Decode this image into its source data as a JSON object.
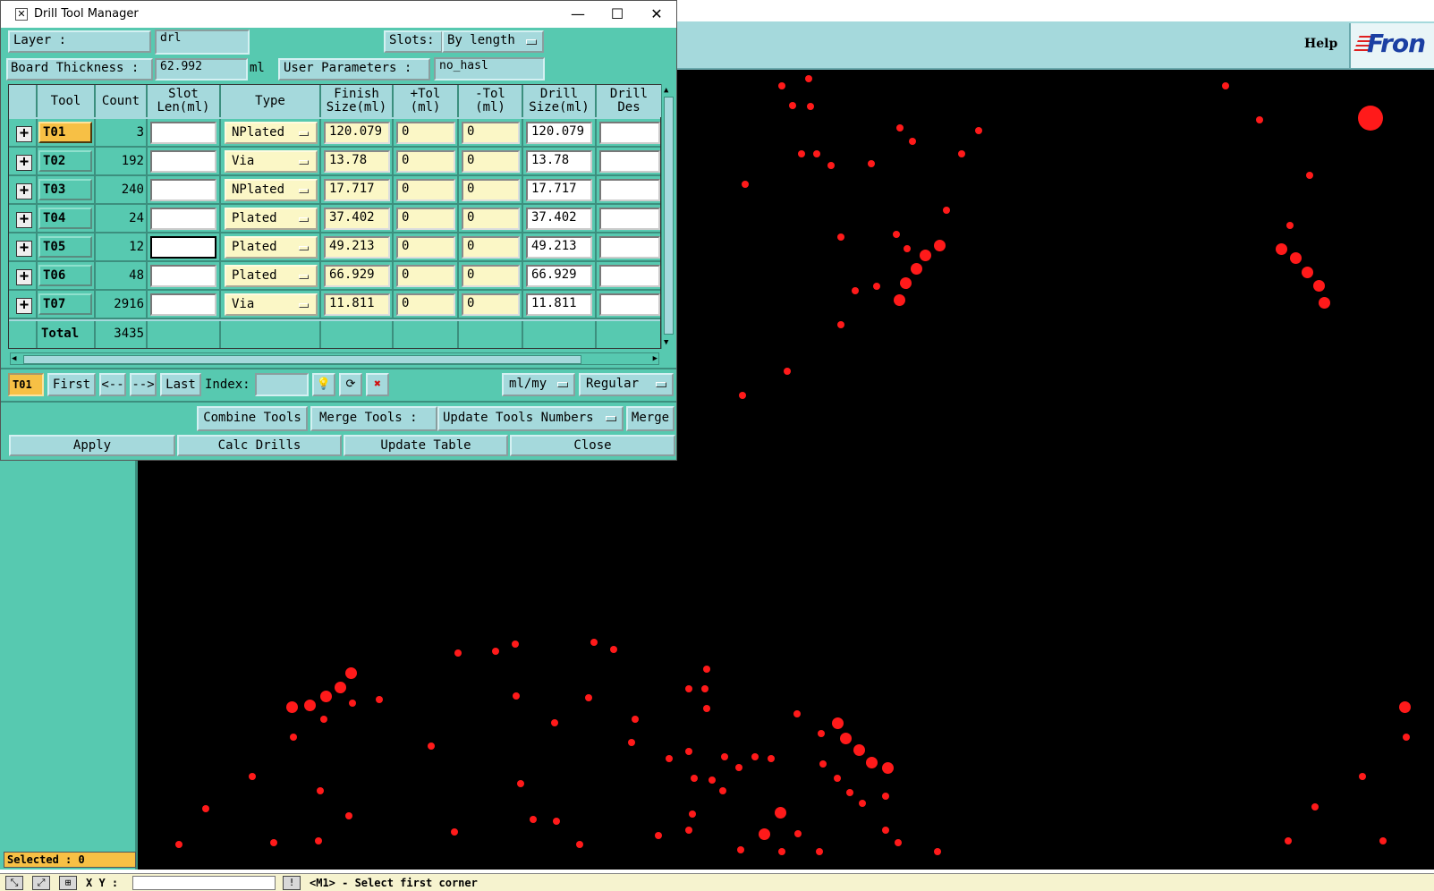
{
  "window": {
    "title": "Drill Tool Manager",
    "icon": "x-box-icon",
    "controls": [
      "minimize-icon",
      "maximize-icon",
      "close-icon"
    ],
    "minimize_glyph": "—",
    "maximize_glyph": "☐",
    "close_glyph": "✕"
  },
  "background_app": {
    "help_label": "Help",
    "logo_text": "Fron",
    "selected_text": "Selected : 0",
    "statusbar": {
      "xy_label": "X Y :",
      "message": "<M1> - Select first corner"
    }
  },
  "header": {
    "layer_label": "Layer             :",
    "layer_value": "drl",
    "slots_label": "Slots:",
    "slots_value": "By length",
    "board_thickness_label": "Board Thickness  :",
    "board_thickness_value": "62.992",
    "board_thickness_unit": "ml",
    "user_params_label": "User Parameters  :",
    "user_params_value": "no_hasl"
  },
  "table": {
    "columns": [
      "Tool",
      "Count",
      "Slot Len(ml)",
      "Type",
      "Finish Size(ml)",
      "+Tol (ml)",
      "-Tol (ml)",
      "Drill Size(ml)",
      "Drill Des"
    ],
    "rows": [
      {
        "tool": "T01",
        "count": "3",
        "slot_len": "",
        "type": "NPlated",
        "finish": "120.079",
        "ptol": "0",
        "mtol": "0",
        "drill": "120.079",
        "des": ""
      },
      {
        "tool": "T02",
        "count": "192",
        "slot_len": "",
        "type": "Via",
        "finish": "13.78",
        "ptol": "0",
        "mtol": "0",
        "drill": "13.78",
        "des": ""
      },
      {
        "tool": "T03",
        "count": "240",
        "slot_len": "",
        "type": "NPlated",
        "finish": "17.717",
        "ptol": "0",
        "mtol": "0",
        "drill": "17.717",
        "des": ""
      },
      {
        "tool": "T04",
        "count": "24",
        "slot_len": "",
        "type": "Plated",
        "finish": "37.402",
        "ptol": "0",
        "mtol": "0",
        "drill": "37.402",
        "des": ""
      },
      {
        "tool": "T05",
        "count": "12",
        "slot_len": "",
        "type": "Plated",
        "finish": "49.213",
        "ptol": "0",
        "mtol": "0",
        "drill": "49.213",
        "des": ""
      },
      {
        "tool": "T06",
        "count": "48",
        "slot_len": "",
        "type": "Plated",
        "finish": "66.929",
        "ptol": "0",
        "mtol": "0",
        "drill": "66.929",
        "des": ""
      },
      {
        "tool": "T07",
        "count": "2916",
        "slot_len": "",
        "type": "Via",
        "finish": "11.811",
        "ptol": "0",
        "mtol": "0",
        "drill": "11.811",
        "des": ""
      }
    ],
    "total_label": "Total",
    "total_count": "3435"
  },
  "nav": {
    "current_tool": "T01",
    "first_label": "First",
    "prev_label": "<--",
    "next_label": "-->",
    "last_label": "Last",
    "index_label": "Index:",
    "index_value": "",
    "units_value": "ml/my",
    "mode_value": "Regular"
  },
  "actions": {
    "combine_label": "Combine Tools",
    "merge_tools_label": "Merge Tools  :",
    "merge_mode_value": "Update Tools Numbers",
    "merge_label": "Merge",
    "apply_label": "Apply",
    "calc_label": "Calc Drills",
    "update_label": "Update Table",
    "close_label": "Close"
  },
  "colors": {
    "panel_green": "#57c9b0",
    "button_blue": "#a5d9dc",
    "active_orange": "#f7c045",
    "drill_red": "#ff1a1a",
    "canvas_black": "#000000"
  }
}
